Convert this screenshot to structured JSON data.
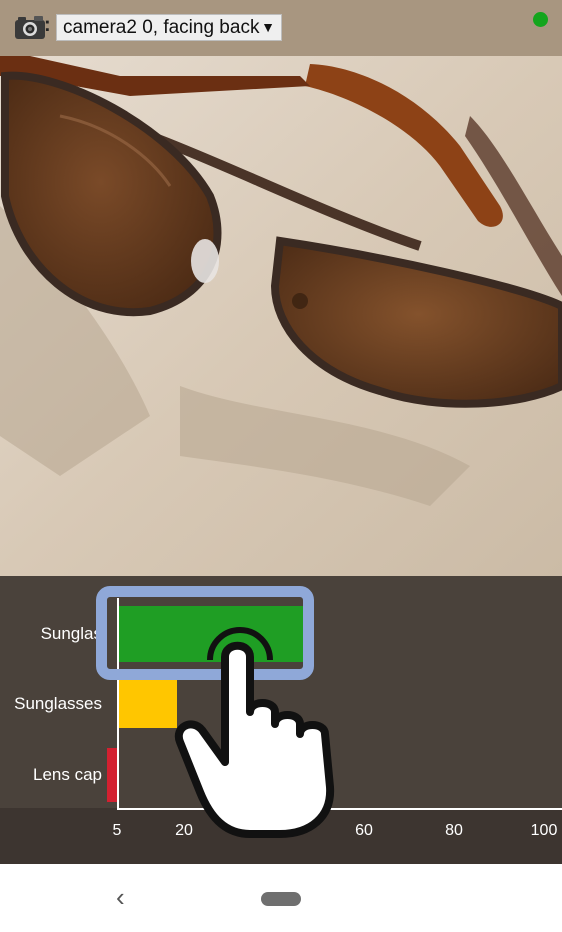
{
  "top_bar": {
    "camera_icon": "camera-icon",
    "separator": ":",
    "camera_selected": "camera2 0, facing back",
    "dropdown_arrow": "▼",
    "status_color": "#14a51d"
  },
  "results": {
    "chart_data": {
      "type": "bar",
      "orientation": "horizontal",
      "categories": [
        "Sunglas",
        "Sunglasses",
        "Lens cap"
      ],
      "values": [
        44,
        13,
        2
      ],
      "colors": [
        "#1f9e24",
        "#ffc600",
        "#d32030"
      ],
      "x_ticks": [
        "5",
        "20",
        "60",
        "80",
        "100"
      ],
      "xlim": [
        0,
        100
      ]
    }
  },
  "nav": {
    "back_icon": "‹"
  }
}
